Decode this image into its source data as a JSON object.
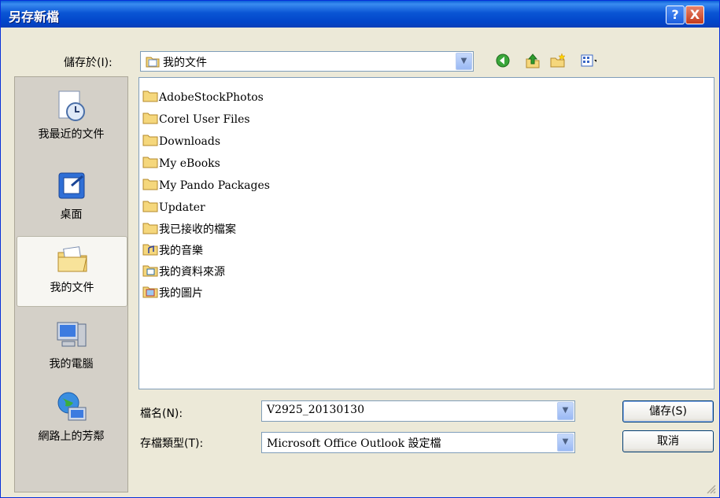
{
  "window": {
    "title": "另存新檔",
    "help_label": "?",
    "close_label": "X"
  },
  "toolbar": {
    "save_in_label": "儲存於(I):",
    "location": "我的文件",
    "icons": [
      "back-icon",
      "up-folder-icon",
      "new-folder-icon",
      "view-menu-icon"
    ]
  },
  "places": [
    {
      "label": "我最近的文件",
      "icon": "recent-documents-icon"
    },
    {
      "label": "桌面",
      "icon": "desktop-icon"
    },
    {
      "label": "我的文件",
      "icon": "my-documents-icon",
      "selected": true
    },
    {
      "label": "我的電腦",
      "icon": "my-computer-icon"
    },
    {
      "label": "網路上的芳鄰",
      "icon": "network-places-icon"
    }
  ],
  "files": [
    {
      "name": "AdobeStockPhotos",
      "icon": "folder-icon"
    },
    {
      "name": "Corel User Files",
      "icon": "folder-icon"
    },
    {
      "name": "Downloads",
      "icon": "folder-icon"
    },
    {
      "name": "My eBooks",
      "icon": "folder-icon"
    },
    {
      "name": "My Pando Packages",
      "icon": "folder-icon"
    },
    {
      "name": "Updater",
      "icon": "folder-icon"
    },
    {
      "name": "我已接收的檔案",
      "icon": "folder-icon"
    },
    {
      "name": "我的音樂",
      "icon": "music-folder-icon"
    },
    {
      "name": "我的資料來源",
      "icon": "feeds-folder-icon"
    },
    {
      "name": "我的圖片",
      "icon": "pictures-folder-icon"
    }
  ],
  "form": {
    "filename_label": "檔名(N):",
    "filename_value": "V2925_20130130",
    "filetype_label": "存檔類型(T):",
    "filetype_value": "Microsoft Office Outlook 設定檔"
  },
  "buttons": {
    "save": "儲存(S)",
    "cancel": "取消"
  },
  "colors": {
    "titlebar": "#0a55d4",
    "dialog": "#ece9d8",
    "selection": "#f7f6f2"
  }
}
